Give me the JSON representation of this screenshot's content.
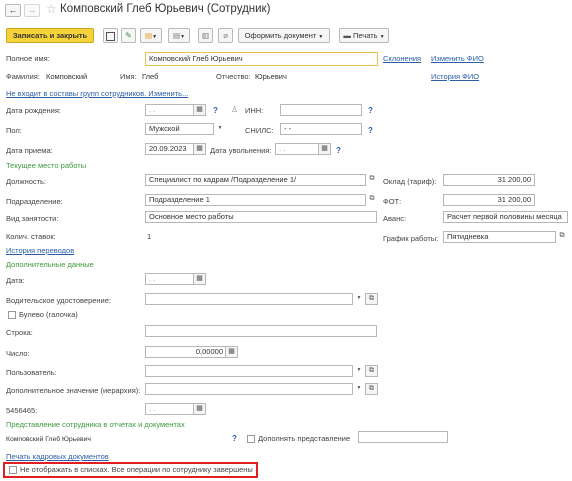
{
  "window": {
    "title": "Комповский Глеб Юрьевич (Сотрудник)"
  },
  "toolbar": {
    "save_close": "Записать и закрыть",
    "format_doc": "Оформить документ",
    "print": "Печать"
  },
  "header": {
    "full_name_label": "Полное имя:",
    "full_name_value": "Комповский Глеб Юрьевич",
    "declensions_link": "Склонения",
    "change_fio_link": "Изменить ФИО",
    "surname_label": "Фамилия:",
    "surname_value": "Комповский",
    "name_label": "Имя:",
    "name_value": "Глеб",
    "patronymic_label": "Отчество:",
    "patronymic_value": "Юрьевич",
    "history_fio_link": "История ФИО",
    "groups_link": "Не входит в составы групп сотрудников. Изменить..."
  },
  "personal": {
    "birth_label": "Дата рождения:",
    "birth_value": ". .",
    "inn_label": "ИНН:",
    "gender_label": "Пол:",
    "gender_value": "Мужской",
    "snils_label": "СНИЛС:",
    "snils_value": "-  -",
    "hire_label": "Дата приема:",
    "hire_value": "20.09.2023",
    "dismiss_label": "Дата увольнения:",
    "dismiss_value": ". ."
  },
  "workplace": {
    "section_title": "Текущее место работы",
    "position_label": "Должность:",
    "position_value": "Специалист по кадрам /Подразделение 1/",
    "salary_label": "Оклад (тариф):",
    "salary_value": "31 200,00",
    "department_label": "Подразделение:",
    "department_value": "Подразделение 1",
    "fot_label": "ФОТ:",
    "fot_value": "31 200,00",
    "employment_label": "Вид занятости:",
    "employment_value": "Основное место работы",
    "advance_label": "Аванс:",
    "advance_value": "Расчет первой половины месяца",
    "rates_label": "Колич. ставок:",
    "rates_value": "1",
    "schedule_label": "График работы:",
    "schedule_value": "Пятидневка",
    "transfers_link": "История переводов"
  },
  "extra": {
    "section_title": "Дополнительные данные",
    "date_label": "Дата:",
    "date_value": ". .",
    "license_label": "Водительское удостоверение:",
    "bool_label": "Булево (галочка)",
    "string_label": "Строка:",
    "number_label": "Число:",
    "number_value": "0,00000",
    "user_label": "Пользователь:",
    "hier_label": "Дополнительное значение (иерархия):",
    "code_label": "5456465:",
    "code_value": ". ."
  },
  "representation": {
    "section_title": "Представление сотрудника в отчетах и документах",
    "value": "Комповский Глеб Юрьевич",
    "extend_label": "Дополнять представление"
  },
  "footer": {
    "print_link": "Печать кадровых документов",
    "hide_label": "Не отображать в списках. Все операции по сотруднику завершены"
  },
  "colors": {
    "save_button": "#f7d33a",
    "section_green": "#3d9a3d",
    "link_blue": "#2a5ea8",
    "highlight_red": "#e02020",
    "active_field_border": "#e8c24a"
  }
}
